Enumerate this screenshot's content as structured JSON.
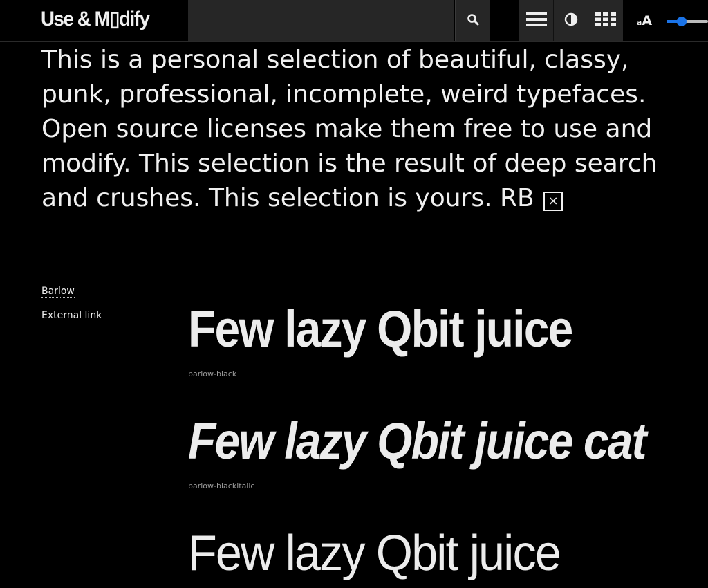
{
  "header": {
    "brand": "Use & M▯dify",
    "search_placeholder": "",
    "icons": {
      "search": "search-icon",
      "list": "list-view-icon",
      "contrast": "contrast-icon",
      "grid": "grid-view-icon",
      "size": "text-size-icon"
    },
    "size_small": "a",
    "size_big": "A",
    "font_size_slider_value": 0.37,
    "accent_color": "#1a73e8"
  },
  "intro": {
    "text": "This is a personal selection of beautiful, classy, punk, professional, incomplete, weird typefaces. Open source licenses make them free to use and modify. This selection is the result of deep search and crushes. This selection is yours. RB",
    "close_symbol": "×"
  },
  "sidebar": {
    "font_name": "Barlow",
    "external_link": "External link"
  },
  "specimens": [
    {
      "text": "Few lazy Qbit juice",
      "label": "barlow-black"
    },
    {
      "text": "Few lazy Qbit juice cat",
      "label": "barlow-blackitalic"
    },
    {
      "text": "Few lazy Qbit juice",
      "label": ""
    }
  ]
}
